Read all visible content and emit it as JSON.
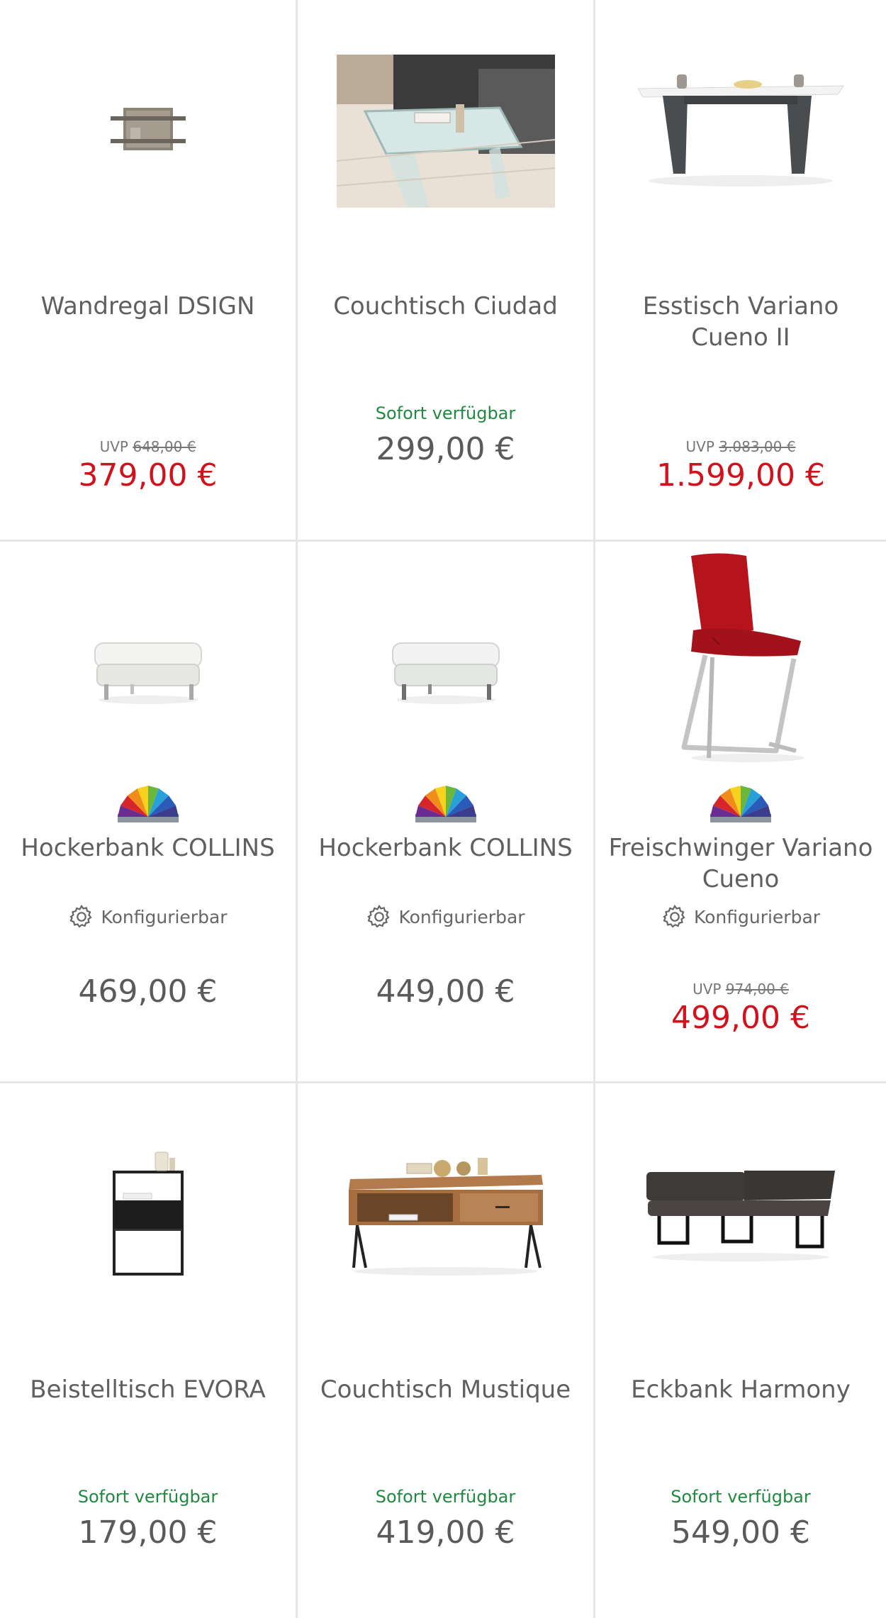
{
  "products": [
    {
      "title": "Wandregal DSIGN",
      "uvp_label": "UVP",
      "uvp": "648,00 €",
      "price": "379,00 €",
      "sale": true,
      "image_icon": "wall-shelf-icon"
    },
    {
      "title": "Couchtisch Ciudad",
      "availability": "Sofort verfügbar",
      "price": "299,00 €",
      "sale": false,
      "image_icon": "glass-coffee-table-photo"
    },
    {
      "title": "Esstisch Variano Cueno II",
      "uvp_label": "UVP",
      "uvp": "3.083,00 €",
      "price": "1.599,00 €",
      "sale": true,
      "image_icon": "dining-table-icon"
    },
    {
      "title": "Hockerbank COLLINS",
      "configurable": "Konfigurierbar",
      "price": "469,00 €",
      "sale": false,
      "image_icon": "ottoman-icon",
      "color_swatch": "color-fan-icon"
    },
    {
      "title": "Hockerbank COLLINS",
      "configurable": "Konfigurierbar",
      "price": "449,00 €",
      "sale": false,
      "image_icon": "ottoman-icon",
      "color_swatch": "color-fan-icon"
    },
    {
      "title": "Freischwinger Variano Cueno",
      "configurable": "Konfigurierbar",
      "uvp_label": "UVP",
      "uvp": "974,00 €",
      "price": "499,00 €",
      "sale": true,
      "image_icon": "cantilever-chair-icon",
      "color_swatch": "color-fan-icon"
    },
    {
      "title": "Beistelltisch EVORA",
      "availability": "Sofort verfügbar",
      "price": "179,00 €",
      "sale": false,
      "image_icon": "side-table-icon"
    },
    {
      "title": "Couchtisch Mustique",
      "availability": "Sofort verfügbar",
      "price": "419,00 €",
      "sale": false,
      "image_icon": "wooden-coffee-table-icon"
    },
    {
      "title": "Eckbank Harmony",
      "availability": "Sofort verfügbar",
      "price": "549,00 €",
      "sale": false,
      "image_icon": "corner-bench-icon"
    }
  ],
  "colors": {
    "sale_price": "#d1121c",
    "regular_price": "#5a5a5a",
    "availability": "#1f8a3f",
    "divider": "#e6e6e6"
  }
}
